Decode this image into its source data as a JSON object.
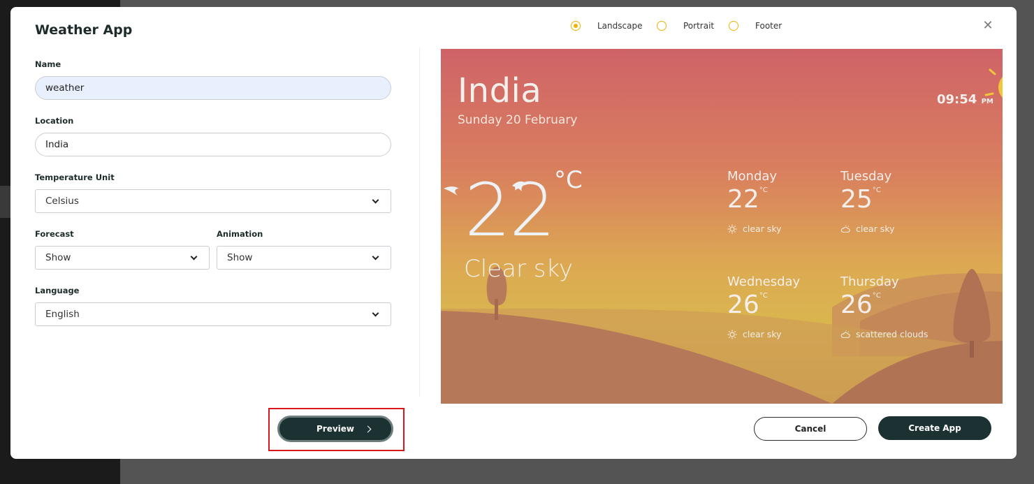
{
  "modal": {
    "title": "Weather App",
    "close_symbol": "✕",
    "orientation": [
      {
        "label": "Landscape",
        "checked": true
      },
      {
        "label": "Portrait",
        "checked": false
      },
      {
        "label": "Footer",
        "checked": false
      }
    ]
  },
  "form": {
    "name_label": "Name",
    "name_value": "weather",
    "location_label": "Location",
    "location_value": "India",
    "temp_unit_label": "Temperature Unit",
    "temp_unit_value": "Celsius",
    "forecast_label": "Forecast",
    "forecast_value": "Show",
    "animation_label": "Animation",
    "animation_value": "Show",
    "language_label": "Language",
    "language_value": "English"
  },
  "buttons": {
    "preview": "Preview",
    "cancel": "Cancel",
    "create": "Create App"
  },
  "preview": {
    "city": "India",
    "date": "Sunday 20 February",
    "time": "09:54",
    "ampm": "PM",
    "temp": "22",
    "unit": "°C",
    "condition": "Clear sky",
    "forecast": [
      {
        "day": "Monday",
        "temp": "22",
        "unit": "°C",
        "desc": "clear sky",
        "icon": "sun-icon"
      },
      {
        "day": "Tuesday",
        "temp": "25",
        "unit": "°C",
        "desc": "clear sky",
        "icon": "cloud-sun-icon"
      },
      {
        "day": "Wednesday",
        "temp": "26",
        "unit": "°C",
        "desc": "clear sky",
        "icon": "sun-icon"
      },
      {
        "day": "Thursday",
        "temp": "26",
        "unit": "°C",
        "desc": "scattered clouds",
        "icon": "cloud-sun-icon"
      }
    ]
  },
  "colors": {
    "accent": "#f0b400",
    "primary_button": "#1c3232",
    "highlight": "#d9161b"
  }
}
